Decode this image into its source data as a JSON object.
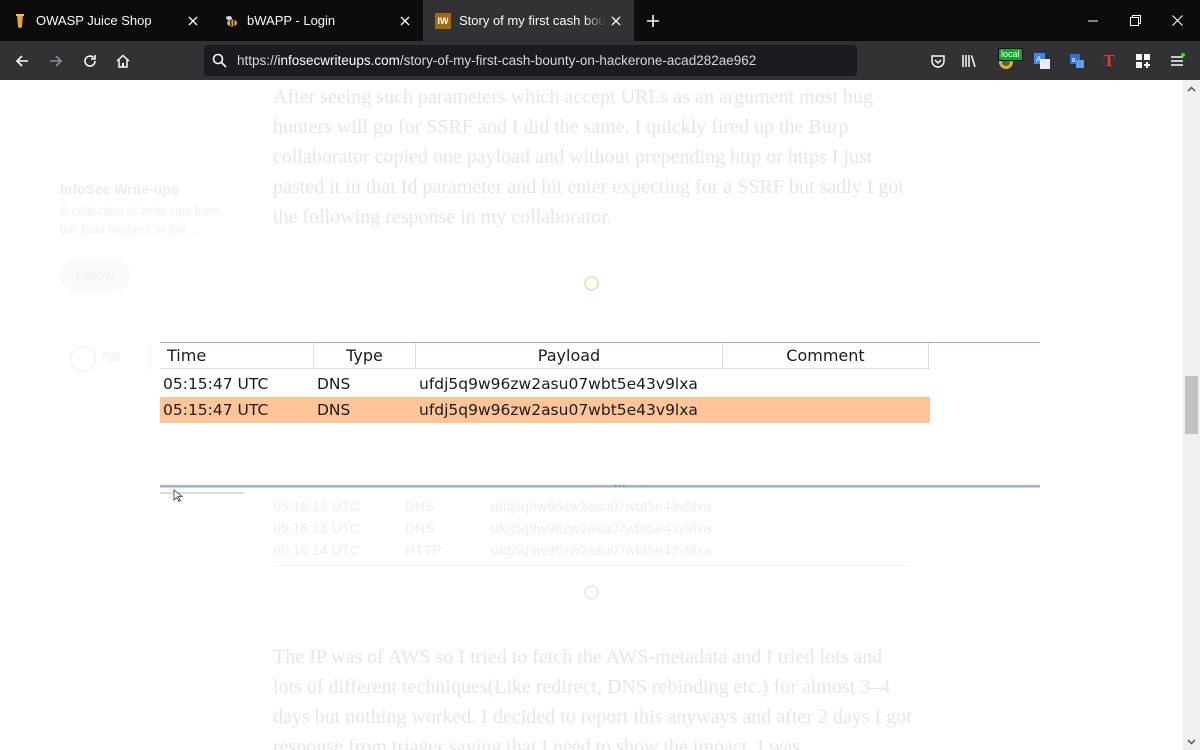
{
  "browser": {
    "tabs": [
      {
        "title": "OWASP Juice Shop",
        "active": false
      },
      {
        "title": "bWAPP - Login",
        "active": false
      },
      {
        "title": "Story of my first cash bounty on HackerOne",
        "active": true,
        "favicon_text": "IW"
      }
    ],
    "url_domain": "infosecwriteups.com",
    "url_prefix": "https://",
    "url_path": "/story-of-my-first-cash-bounty-on-hackerone-acad282ae962",
    "local_badge": "local",
    "toolbar_letter": "T"
  },
  "article": {
    "para1": "After seeing such parameters which accept URLs as an argument most bug hunters will go for SSRF and I did the same. I quickly fired up the Burp collaborator copied one payload and without prepending http or https I just pasted it in that Id parameter and hit enter expecting for a SSRF but sadly I got the following response in my collaborator.",
    "para2": "The IP was of AWS so I tried to fetch the AWS-metadata and I tried lots and lots of different techniques(Like redirect, DNS rebinding etc.) for almost 3–4 days but nothing worked. I decided to report this anyways and after 2 days I got response from triager saying that I need to show the impact. I was"
  },
  "sidebar": {
    "publication": "InfoSec Write-ups",
    "description": "A collection of write-ups from the best hackers in the...",
    "follow_label": "Follow",
    "claps": "708"
  },
  "burp_table": {
    "columns": [
      "Time",
      "Type",
      "Payload",
      "Comment"
    ],
    "rows": [
      {
        "time": "05:15:47 UTC",
        "type": "DNS",
        "payload": "ufdj5q9w96zw2asu07wbt5e43v9lxa",
        "comment": "",
        "selected": false
      },
      {
        "time": "05:15:47 UTC",
        "type": "DNS",
        "payload": "ufdj5q9w96zw2asu07wbt5e43v9lxa",
        "comment": "",
        "selected": true
      }
    ]
  },
  "faded_rows": [
    {
      "time": "05:16:13 UTC",
      "type": "DNS",
      "payload": "ufdj5q9w96zw2asu07wbt5e43v9lxa"
    },
    {
      "time": "05:16:13 UTC",
      "type": "DNS",
      "payload": "ufdj5q9w96zw2asu07wbt5e43v9lxa"
    },
    {
      "time": "05:16:14 UTC",
      "type": "HTTP",
      "payload": "ufdj5q9w96zw2asu07wbt5e43v9lxa"
    }
  ],
  "colors": {
    "tab_bg": "#0c0c0d",
    "toolbar_bg": "#323234",
    "selected_row": "#ffc599",
    "faded_text": "#e6e6e6"
  }
}
